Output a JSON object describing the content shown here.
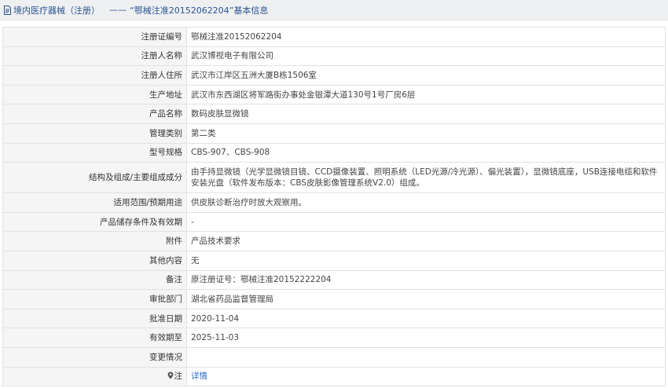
{
  "header": {
    "category": "境内医疗器械（注册）",
    "separator": "——",
    "record": "“鄂械注准20152062204”基本信息"
  },
  "rows": [
    {
      "label": "注册证编号",
      "value": "鄂械注准20152062204"
    },
    {
      "label": "注册人名称",
      "value": "武汉博视电子有限公司"
    },
    {
      "label": "注册人住所",
      "value": "武汉市江岸区五洲大厦B栋1506室"
    },
    {
      "label": "生产地址",
      "value": "武汉市东西湖区将军路街办事处金银潭大道130号1号厂房6层"
    },
    {
      "label": "产品名称",
      "value": "数码皮肤显微镜"
    },
    {
      "label": "管理类别",
      "value": "第二类"
    },
    {
      "label": "型号规格",
      "value": "CBS-907、CBS-908"
    },
    {
      "label": "结构及组成/主要组成成分",
      "value": "由手持显微镜（光学显微镜目镜、CCD摄像装置、照明系统（LED光源/冷光源）、偏光装置），显微镜底座，USB连接电缆和软件安装光盘（软件发布版本：CBS皮肤影像管理系统V2.0）组成。"
    },
    {
      "label": "适用范围/预期用途",
      "value": "供皮肤诊断治疗时放大观察用。"
    },
    {
      "label": "产品储存条件及有效期",
      "value": "-"
    },
    {
      "label": "附件",
      "value": "产品技术要求"
    },
    {
      "label": "其他内容",
      "value": "无"
    },
    {
      "label": "备注",
      "value": "原注册证号：鄂械注准20152222204"
    },
    {
      "label": "审批部门",
      "value": "湖北省药品监督管理局"
    },
    {
      "label": "批准日期",
      "value": "2020-11-04"
    },
    {
      "label": "有效期至",
      "value": "2025-11-03"
    },
    {
      "label": "变更情况",
      "value": ""
    },
    {
      "label": "注",
      "value": "详情"
    }
  ],
  "icons": {
    "title_icon": "document-icon",
    "note_icon": "pin-icon"
  },
  "colors": {
    "header_text": "#2a5590",
    "header_bg": "#eff0f2",
    "label_bg": "#f5f5f5",
    "border": "#e2e2e2",
    "link": "#2f6cc9"
  }
}
